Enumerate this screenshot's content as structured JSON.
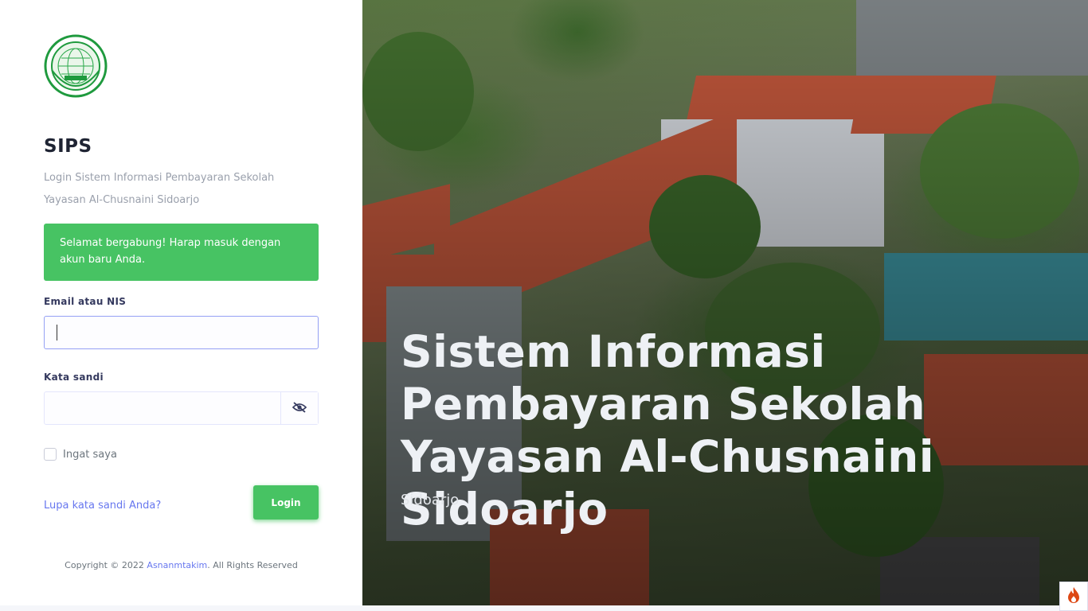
{
  "brand": {
    "logo_text_top": "YAYASAN",
    "logo_text_bottom": "AL-CHUSNAINI",
    "app_title": "SIPS",
    "subtitle": "Login Sistem Informasi Pembayaran Sekolah Yayasan Al-Chusnaini Sidoarjo"
  },
  "alert": {
    "message": "Selamat bergabung! Harap masuk dengan akun baru Anda.",
    "color": "#47c363"
  },
  "form": {
    "email_label": "Email atau NIS",
    "email_value": "",
    "password_label": "Kata sandi",
    "password_value": "",
    "password_toggle_icon": "eye-slash-icon",
    "remember_label": "Ingat saya",
    "remember_checked": false,
    "forgot_link": "Lupa kata sandi Anda?",
    "login_button": "Login"
  },
  "footer": {
    "prefix": "Copyright © 2022",
    "author": "Asnanmtakim",
    "suffix": ". All Rights Reserved"
  },
  "hero": {
    "title": "Sistem Informasi Pembayaran Sekolah Yayasan Al-Chusnaini Sidoarjo",
    "subtitle": "Sidoarjo"
  },
  "colors": {
    "accent": "#6777ef",
    "success": "#47c363",
    "title": "#1f2433"
  },
  "debug_badge_icon": "flame-icon"
}
